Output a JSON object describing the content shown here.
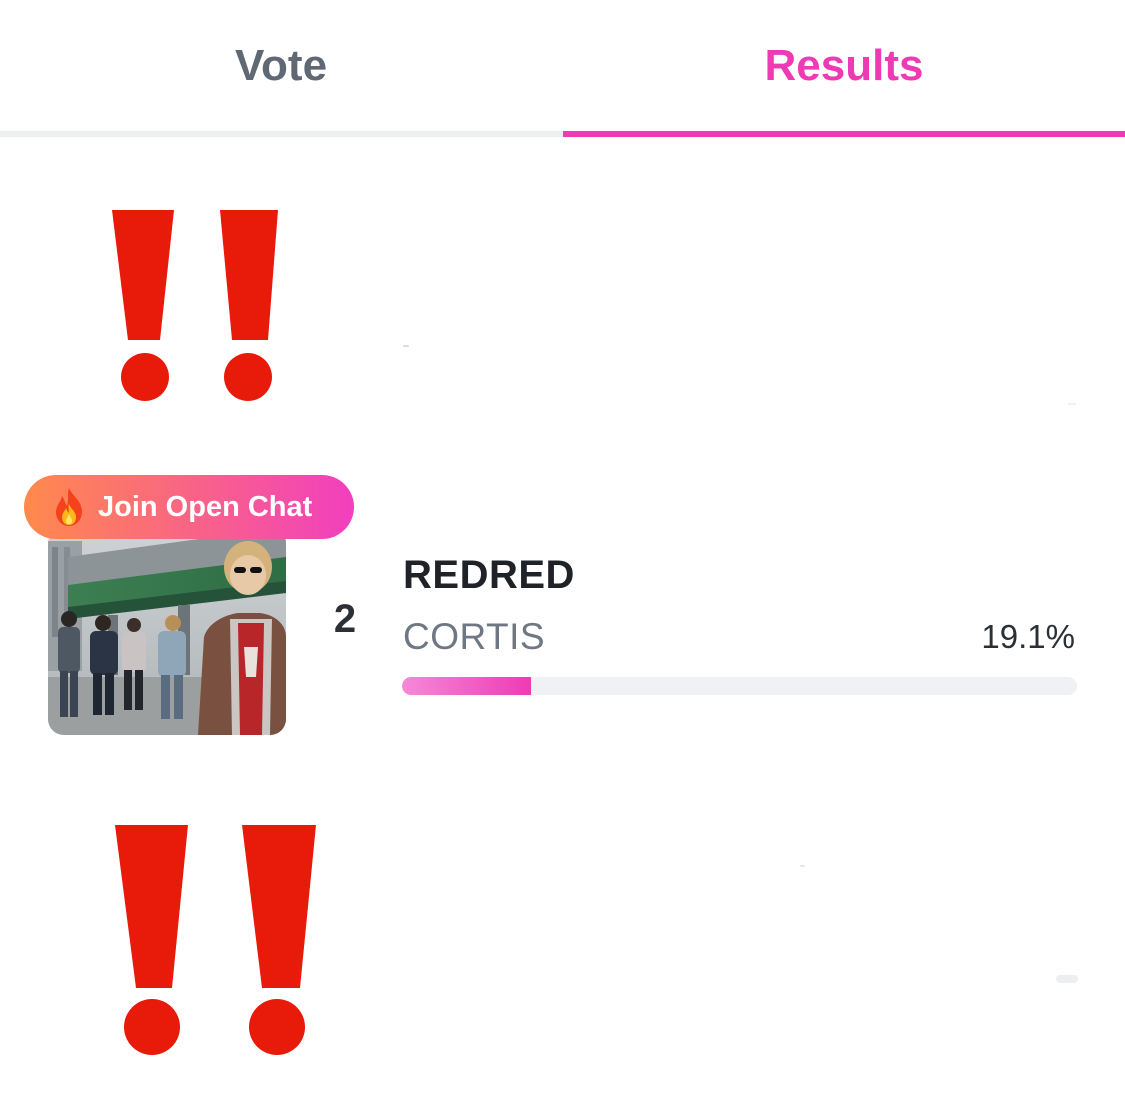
{
  "tabs": {
    "vote_label": "Vote",
    "results_label": "Results",
    "active": "results"
  },
  "colors": {
    "accent_pink": "#ee3bb4",
    "tab_inactive": "#5f6873",
    "exclaim_red": "#e81a0a",
    "pill_start": "#ff8a4c",
    "pill_end": "#f23fbf"
  },
  "open_chat": {
    "icon": "fire-icon",
    "label": "Join Open Chat"
  },
  "result_item": {
    "rank": "2",
    "title": "REDRED",
    "artist": "CORTIS",
    "percent_label": "19.1%",
    "progress_fraction": 0.191
  },
  "decorations": {
    "top_icon": "double-exclamation-icon",
    "bottom_icon": "double-exclamation-icon"
  }
}
